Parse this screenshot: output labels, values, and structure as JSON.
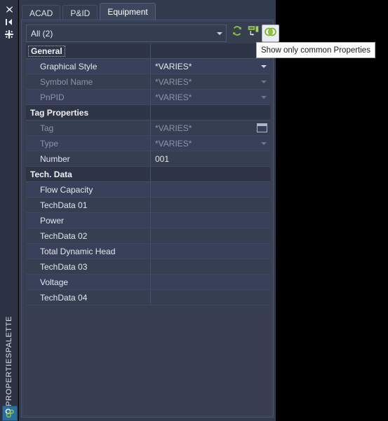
{
  "window": {
    "dock_title": "PROPERTIESPALETTE",
    "app_icon": "properties-palette-icon"
  },
  "dock_buttons": [
    {
      "name": "close-icon",
      "label": "Close"
    },
    {
      "name": "auto-hide-icon",
      "label": "Auto-hide"
    },
    {
      "name": "panel-menu-icon",
      "label": "Properties"
    }
  ],
  "tabs": [
    {
      "label": "ACAD",
      "active": false
    },
    {
      "label": "P&ID",
      "active": false
    },
    {
      "label": "Equipment",
      "active": true
    }
  ],
  "filter": {
    "value": "All (2)",
    "placeholder": "All (2)",
    "arrow": "chevron-down-icon"
  },
  "toolbar": [
    {
      "name": "refresh-button",
      "icon": "refresh-icon",
      "active": false
    },
    {
      "name": "select-objects-button",
      "icon": "select-objects-icon",
      "active": false
    },
    {
      "name": "show-common-properties-button",
      "icon": "show-common-properties-icon",
      "active": true
    }
  ],
  "tooltip": {
    "text": "Show only common Properties"
  },
  "colors": {
    "accent_green": "#7fbe2e",
    "panel_bg": "#323a4d",
    "row_bg": "#39415a",
    "row_alt_bg": "#363e52",
    "section_bg": "#2d3546",
    "text": "#e3e7ee",
    "text_dim": "#8b94a8",
    "tooltip_bg": "#fdfdfd"
  },
  "sections": [
    {
      "title": "General",
      "focused": true,
      "rows": [
        {
          "name": "Graphical Style",
          "value": "*VARIES*",
          "dim": false,
          "control": "dropdown"
        },
        {
          "name": "Symbol Name",
          "value": "*VARIES*",
          "dim": true,
          "control": "dropdown"
        },
        {
          "name": "PnPID",
          "value": "*VARIES*",
          "dim": true,
          "control": "dropdown"
        }
      ]
    },
    {
      "title": "Tag Properties",
      "focused": false,
      "rows": [
        {
          "name": "Tag",
          "value": "*VARIES*",
          "dim": true,
          "control": "browse"
        },
        {
          "name": "Type",
          "value": "*VARIES*",
          "dim": true,
          "control": "dropdown"
        },
        {
          "name": "Number",
          "value": "001",
          "dim": false,
          "control": "text"
        }
      ]
    },
    {
      "title": "Tech. Data",
      "focused": false,
      "rows": [
        {
          "name": "Flow Capacity",
          "value": "",
          "dim": false,
          "control": "text"
        },
        {
          "name": "TechData 01",
          "value": "",
          "dim": false,
          "control": "text"
        },
        {
          "name": "Power",
          "value": "",
          "dim": false,
          "control": "text"
        },
        {
          "name": "TechData 02",
          "value": "",
          "dim": false,
          "control": "text"
        },
        {
          "name": "Total Dynamic Head",
          "value": "",
          "dim": false,
          "control": "text"
        },
        {
          "name": "TechData 03",
          "value": "",
          "dim": false,
          "control": "text"
        },
        {
          "name": "Voltage",
          "value": "",
          "dim": false,
          "control": "text"
        },
        {
          "name": "TechData 04",
          "value": "",
          "dim": false,
          "control": "text"
        }
      ]
    }
  ]
}
